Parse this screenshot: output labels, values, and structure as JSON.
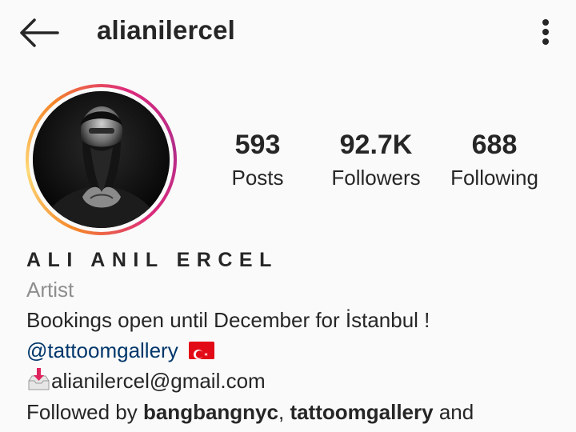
{
  "header": {
    "username": "alianilercel",
    "back_icon": "arrow-left-icon",
    "more_icon": "more-vertical-icon"
  },
  "stats": {
    "posts_count": "593",
    "posts_label": "Posts",
    "followers_count": "92.7K",
    "followers_label": "Followers",
    "following_count": "688",
    "following_label": "Following"
  },
  "profile": {
    "full_name": "ALI ANIL ERCEL",
    "category": "Artist",
    "bio_line1": "Bookings open until December for İstanbul !",
    "mention": "@tattoomgallery",
    "email": "alianilercel@gmail.com",
    "followed_by_prefix": "Followed by ",
    "followed_by_user1": "bangbangnyc",
    "followed_by_separator": ", ",
    "followed_by_user2": "tattoomgallery",
    "followed_by_suffix": " and"
  },
  "colors": {
    "background": "#fafafa",
    "text": "#262626",
    "secondary_text": "#8e8e8e",
    "link": "#00376b",
    "story_ring_start": "#f58529",
    "story_ring_mid": "#dd2a7b",
    "story_ring_end": "#b32d8a"
  }
}
